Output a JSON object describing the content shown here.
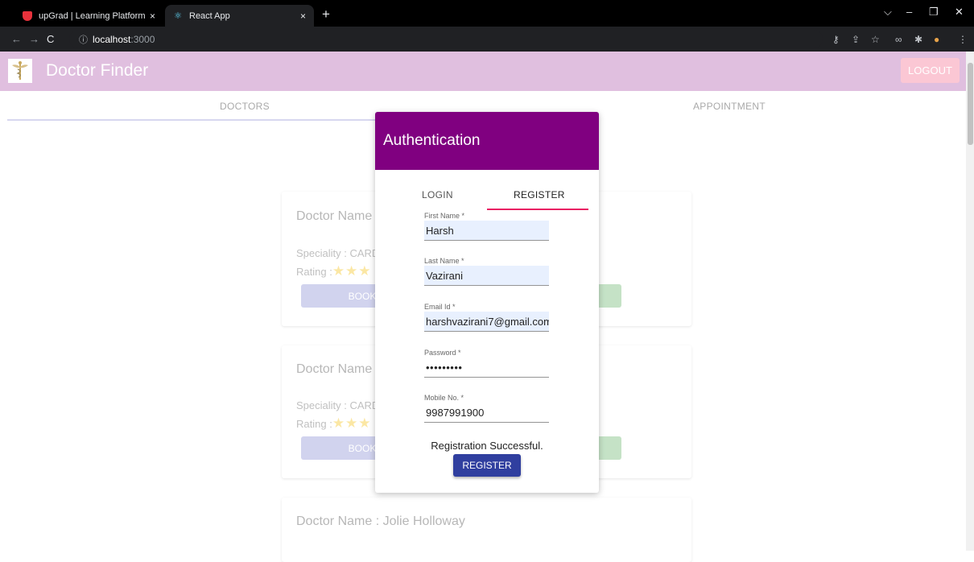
{
  "browser": {
    "tabs": [
      {
        "title": "upGrad | Learning Platform",
        "close": "×"
      },
      {
        "title": "React App",
        "close": "×"
      }
    ],
    "new_tab": "+",
    "url_host": "localhost",
    "url_port": ":3000"
  },
  "app": {
    "title": "Doctor Finder",
    "logout_label": "LOGOUT",
    "tabs": [
      "DOCTORS",
      "APPOINTMENT"
    ]
  },
  "cards": [
    {
      "doctor_name": "Doctor Name :",
      "speciality": "Speciality : CARD",
      "rating": "Rating :",
      "book": "BOOK APP"
    },
    {
      "doctor_name": "Doctor Name :",
      "speciality": "Speciality : CARD",
      "rating": "Rating :",
      "book": "BOOK APP"
    },
    {
      "doctor_name": "Doctor Name : Jolie Holloway"
    }
  ],
  "modal": {
    "title": "Authentication",
    "tabs": {
      "login": "LOGIN",
      "register": "REGISTER"
    },
    "fields": [
      {
        "label": "First Name *",
        "value": "Harsh"
      },
      {
        "label": "Last Name *",
        "value": "Vazirani"
      },
      {
        "label": "Email Id *",
        "value": "harshvazirani7@gmail.com"
      },
      {
        "label": "Password *",
        "value": "•••••••••"
      },
      {
        "label": "Mobile No. *",
        "value": "9987991900"
      }
    ],
    "message": "Registration Successful.",
    "register_button": "REGISTER"
  },
  "colors": {
    "appbar": "#e0bfdf",
    "modal_header": "#800080",
    "tab_indicator": "#e91e63",
    "primary_button": "#303f9f"
  }
}
